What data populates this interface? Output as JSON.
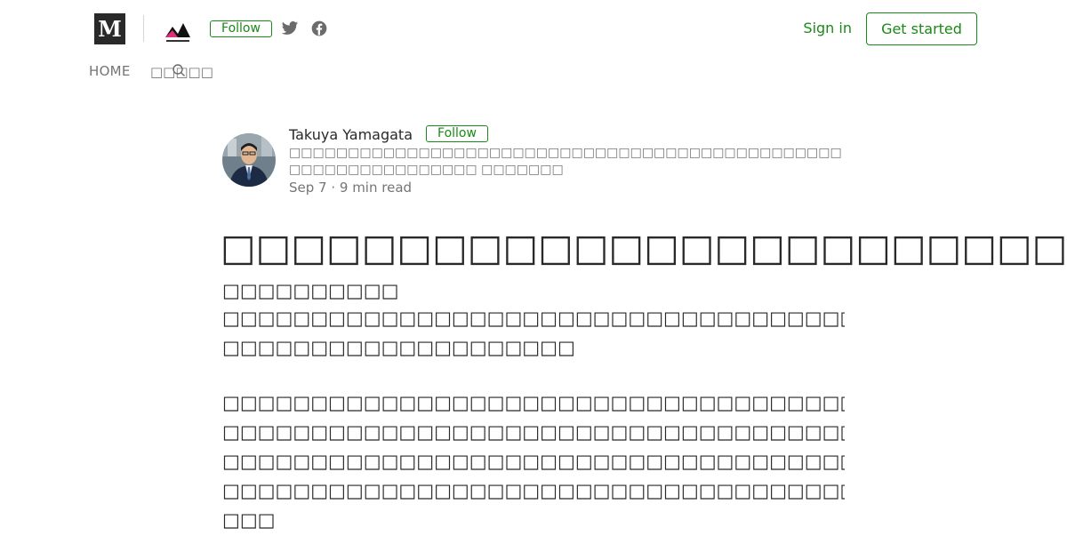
{
  "header": {
    "logo_letter": "M",
    "publication_follow_label": "Follow",
    "sign_in_label": "Sign in",
    "get_started_label": "Get started",
    "accent_color": "#1a8917"
  },
  "subnav": {
    "home_label": "HOME",
    "category_label": "□□□□□"
  },
  "author": {
    "name": "Takuya Yamagata",
    "follow_label": "Follow",
    "bio": "□□□□□□□□□□□□□□□□□□□□□□□□□□□□□□□□□□□□□□□□□□□□□□□□□□□□□□□□□□□□□□□ □□□□□□□",
    "meta": "Sep 7 · 9 min read"
  },
  "article": {
    "title": "□□□□□□□□□□□□□□□□□□□□□□□□□",
    "subtitle": "□□□□□□□□□□",
    "paragraph_1": [
      "□□□□□□□□□□□□□□□□□□□□□□□□□□□□□□□□□□□□□□□□□□□□□□□□□□□□□",
      "□□□□□□□□□□□□□□□□□□□□"
    ],
    "paragraph_2": [
      "□□□□□□□□□□□□□□□□□□□□□□□□□□□□□□□□□□□□□□□□□□□□□□□□□",
      "□□□□□□□□□□□□□□□□□□□□□□□□□□□□□□□□□□□□□□□□□□□□□",
      "□□□□□□□□□□□□□□□□□□□□□□□□□□□□□□□□□□□□□□□□□□□□□□□□□□□□□",
      "□□□□□□□□□□□□□□□□□□□□□□□□□□□□□□□□□□□□□□□□□□□□□□□□□□□□",
      "□□□"
    ]
  }
}
